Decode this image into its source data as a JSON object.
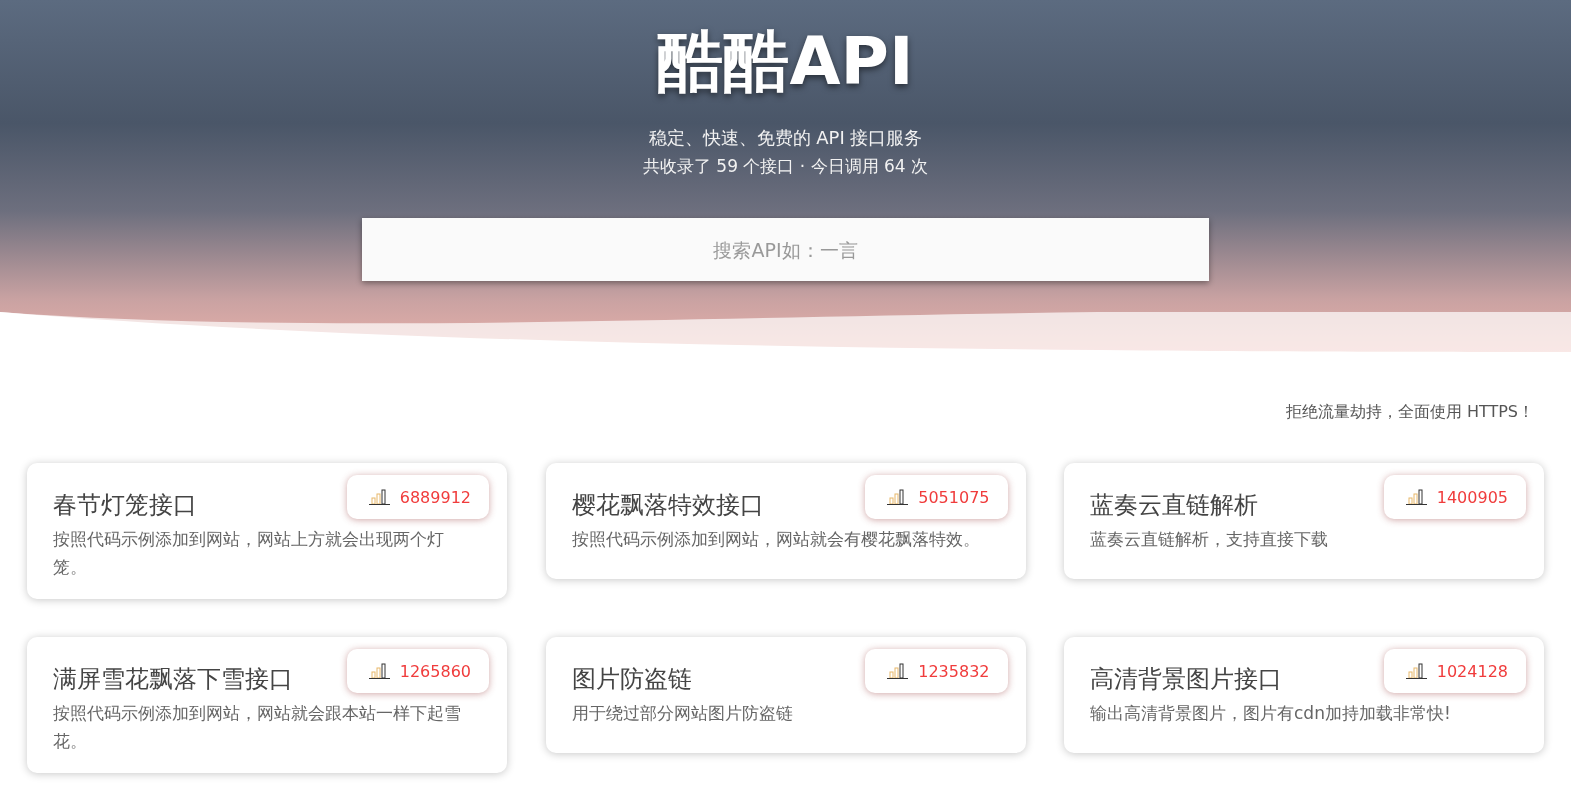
{
  "header": {
    "title": "酷酷API",
    "subtitle": "稳定、快速、免费的 API 接口服务",
    "stats": "共收录了 59 个接口 · 今日调用 64 次",
    "search": {
      "placeholder": "搜索API如：一言"
    }
  },
  "notice": "拒绝流量劫持，全面使用 HTTPS！",
  "apis": [
    {
      "name": "春节灯笼接口",
      "count": "6889912",
      "description": "按照代码示例添加到网站，网站上方就会出现两个灯笼。"
    },
    {
      "name": "樱花飘落特效接口",
      "count": "5051075",
      "description": "按照代码示例添加到网站，网站就会有樱花飘落特效。"
    },
    {
      "name": "蓝奏云直链解析",
      "count": "1400905",
      "description": "蓝奏云直链解析，支持直接下载"
    },
    {
      "name": "满屏雪花飘落下雪接口",
      "count": "1265860",
      "description": "按照代码示例添加到网站，网站就会跟本站一样下起雪花。"
    },
    {
      "name": "图片防盗链",
      "count": "1235832",
      "description": "用于绕过部分网站图片防盗链"
    },
    {
      "name": "高清背景图片接口",
      "count": "1024128",
      "description": "输出高清背景图片，图片有cdn加持加载非常快!"
    }
  ]
}
